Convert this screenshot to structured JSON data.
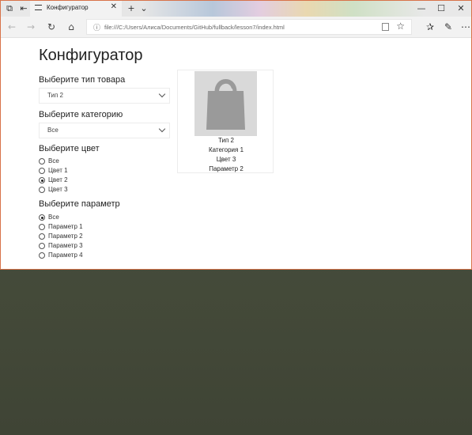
{
  "browser": {
    "tab_title": "Конфигуратор",
    "url": "file:///C:/Users/Алиса/Documents/GitHub/fullback/lesson7/index.html"
  },
  "page": {
    "title": "Конфигуратор",
    "type_section": {
      "label": "Выберите тип товара",
      "selected": "Тип 2"
    },
    "category_section": {
      "label": "Выберите категорию",
      "selected": "Все"
    },
    "color_section": {
      "label": "Выберите цвет",
      "options": [
        "Все",
        "Цвет 1",
        "Цвет 2",
        "Цвет 3"
      ],
      "checked_index": 2
    },
    "param_section": {
      "label": "Выберите параметр",
      "options": [
        "Все",
        "Параметр 1",
        "Параметр 2",
        "Параметр 3",
        "Параметр 4"
      ],
      "checked_index": 0
    },
    "product_card": {
      "icon": "shopping-bag-icon",
      "icon_color": "#9a9a9a",
      "image_bg": "#d9d9d9",
      "type": "Тип 2",
      "category": "Категория 1",
      "color": "Цвет 3",
      "param": "Параметр 2"
    }
  }
}
